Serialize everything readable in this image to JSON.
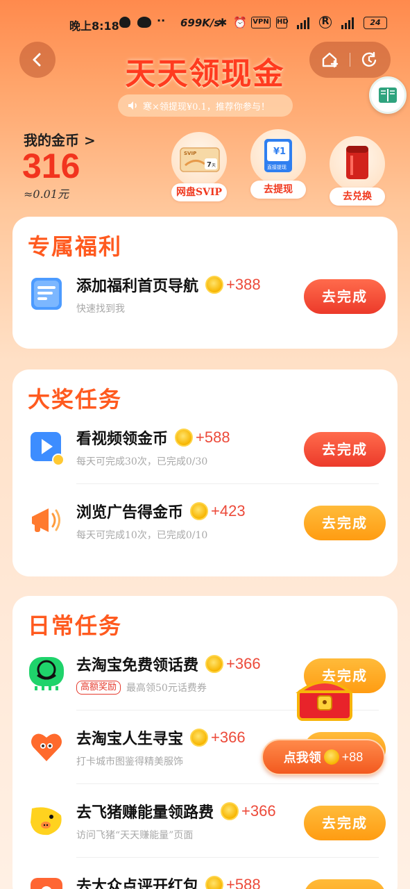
{
  "status_bar": {
    "time": "晚上8:18",
    "dots": "··",
    "speed": "699K/s",
    "vpn": "VPN",
    "hd": "HD",
    "battery": "24"
  },
  "header": {
    "title": "天天领现金",
    "notice": "寒×领提现¥0.1，推荐你参与！"
  },
  "coins": {
    "label": "我的金币 >",
    "value": "316",
    "money": "≈0.01元"
  },
  "shortcuts": [
    {
      "label": "网盘SVIP",
      "badge": "SVIP",
      "days": "7天"
    },
    {
      "label": "去提现",
      "badge": "¥1",
      "sub": "直接提现"
    },
    {
      "label": "去兑换"
    }
  ],
  "cards": {
    "exclusive": {
      "title": "专属福利",
      "tasks": [
        {
          "name": "添加福利首页导航",
          "reward": "+388",
          "sub": "快速找到我",
          "button": "去完成"
        }
      ]
    },
    "grand": {
      "title": "大奖任务",
      "tasks": [
        {
          "name": "看视频领金币",
          "reward": "+588",
          "sub": "每天可完成30次，已完成0/30",
          "button": "去完成"
        },
        {
          "name": "浏览广告得金币",
          "reward": "+423",
          "sub": "每天可完成10次，已完成0/10",
          "button": "去完成"
        }
      ]
    },
    "daily": {
      "title": "日常任务",
      "tasks": [
        {
          "name": "去淘宝免费领话费",
          "reward": "+366",
          "tag": "高额奖励",
          "sub": "最高领50元话费券",
          "button": "去完成"
        },
        {
          "name": "去淘宝人生寻宝",
          "reward": "+366",
          "sub": "打卡城市图鉴得精美服饰",
          "button": "去完成"
        },
        {
          "name": "去飞猪赚能量领路费",
          "reward": "+366",
          "sub": "访问飞猪“天天赚能量”页面",
          "button": "去完成"
        },
        {
          "name": "去大众点评开红包",
          "reward": "+588",
          "sub": "",
          "button": "去完成"
        }
      ]
    }
  },
  "chest": {
    "label": "点我领",
    "reward": "+88"
  }
}
